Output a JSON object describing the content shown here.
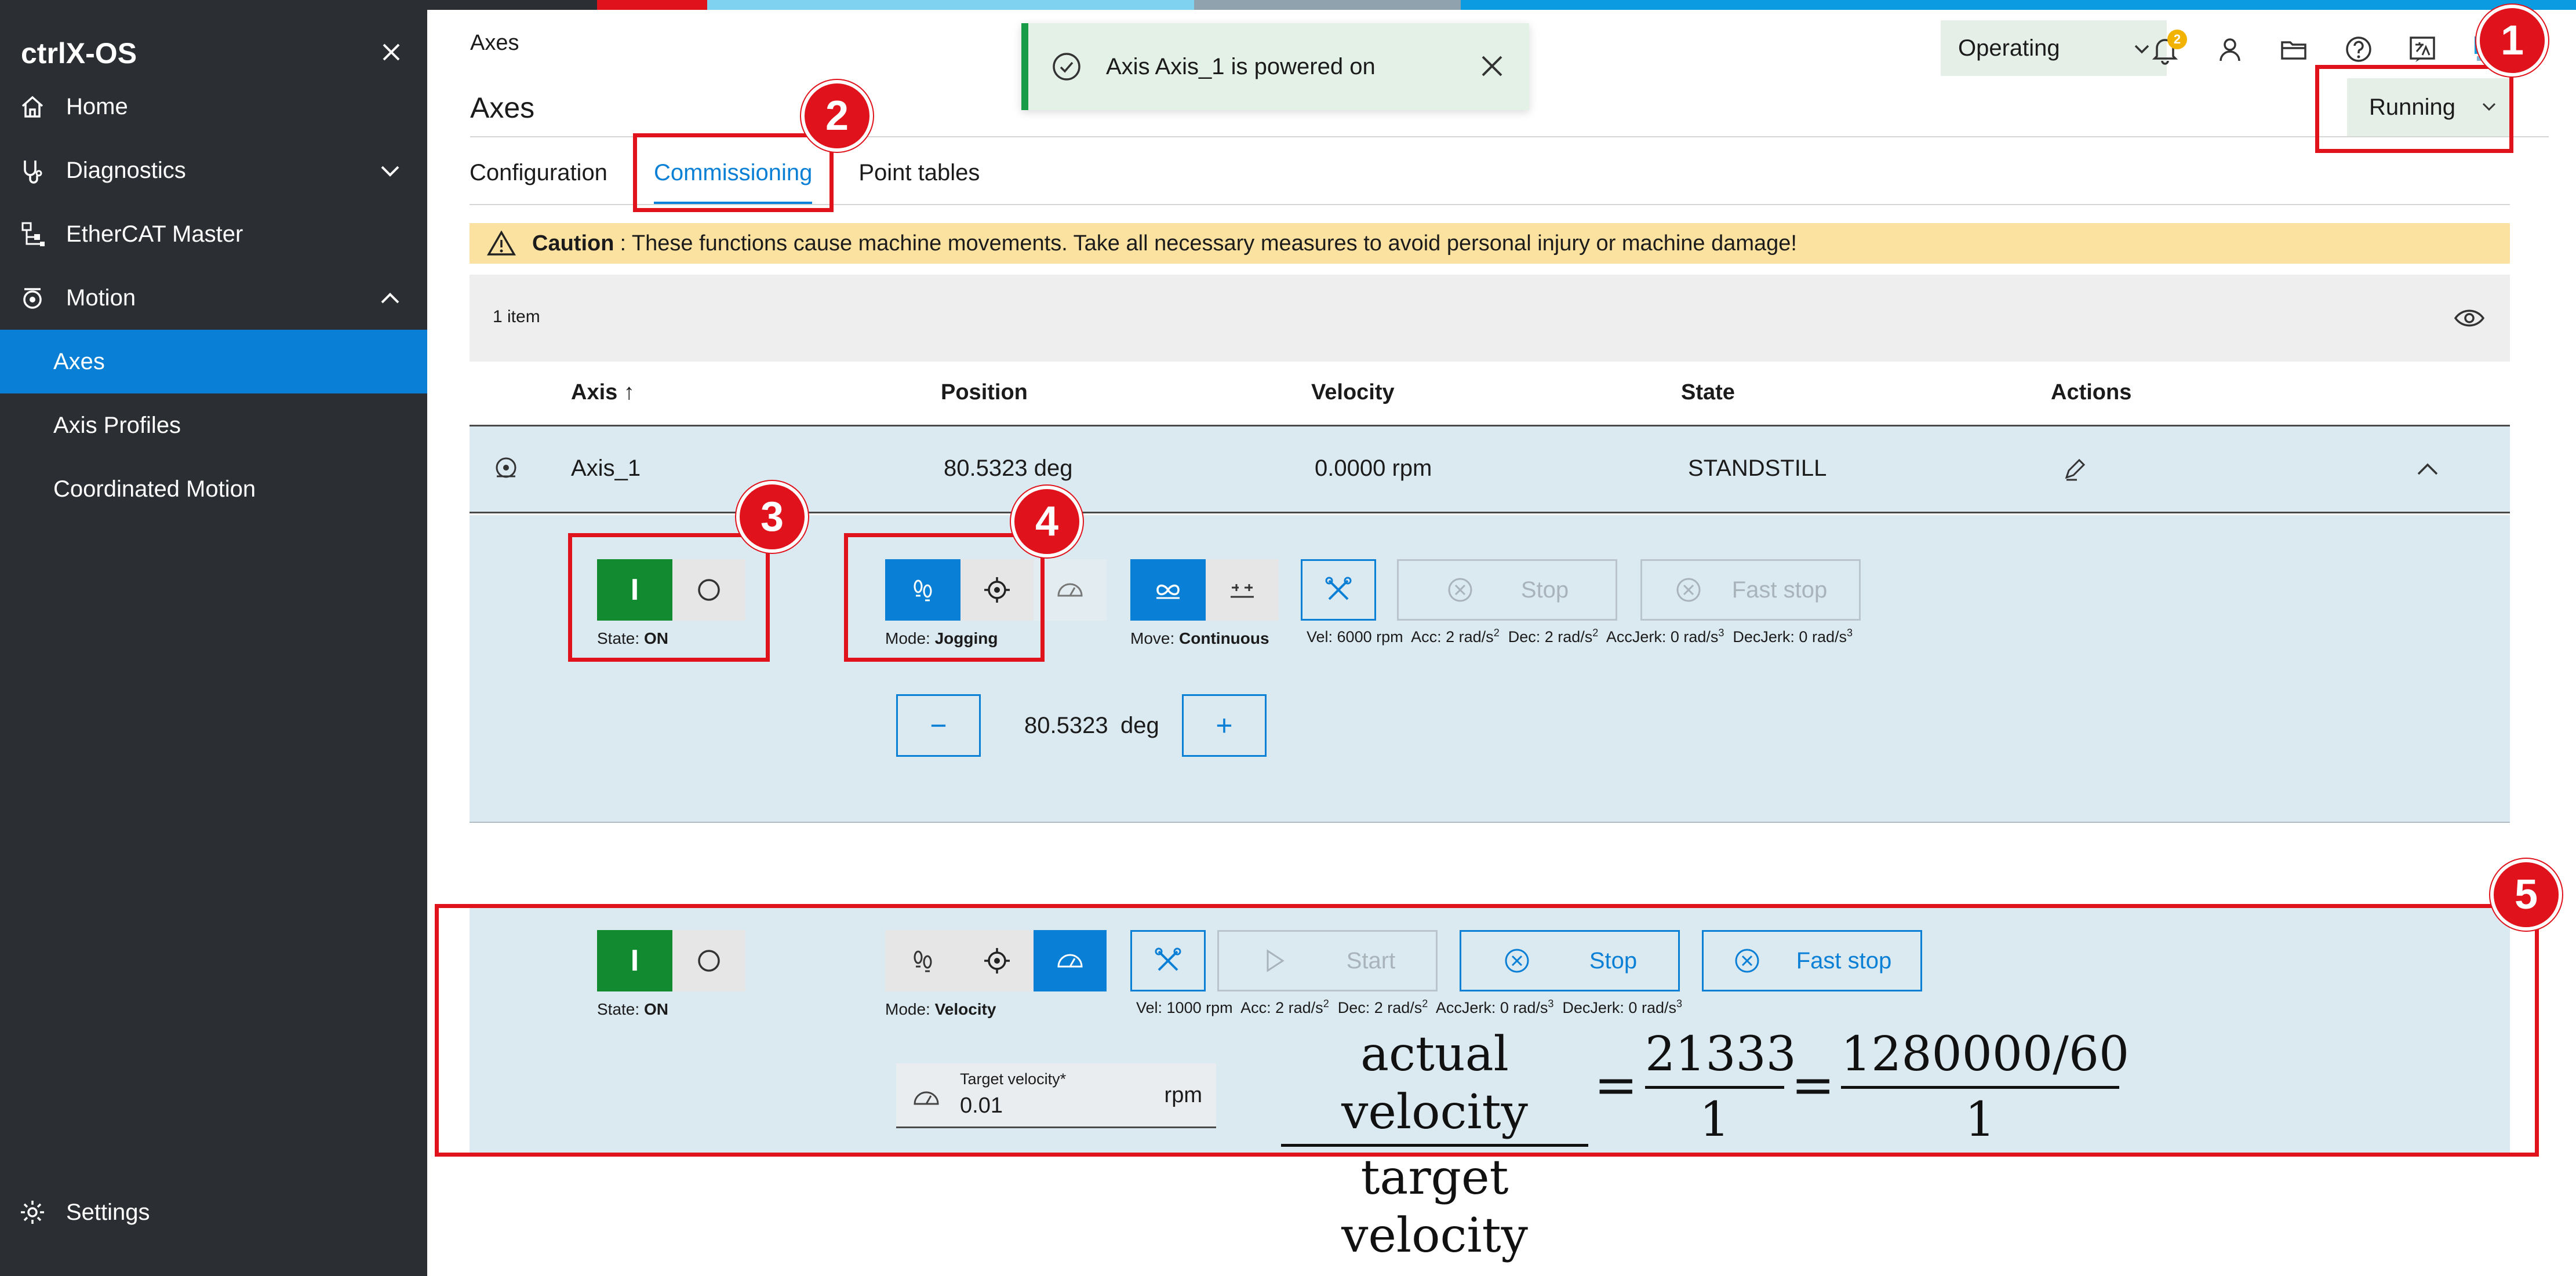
{
  "app": {
    "brand": "ctrlX-OS",
    "topbar_colors": [
      "#2b2e33",
      "#e0121b",
      "#7fd3f0",
      "#8fa2ad",
      "#0a9be0"
    ]
  },
  "sidebar": {
    "items": [
      {
        "label": "Home",
        "icon": "home-icon"
      },
      {
        "label": "Diagnostics",
        "icon": "stethoscope-icon"
      },
      {
        "label": "EtherCAT Master",
        "icon": "network-icon"
      },
      {
        "label": "Motion",
        "icon": "motion-icon"
      },
      {
        "label": "Axes"
      },
      {
        "label": "Axis Profiles"
      },
      {
        "label": "Coordinated Motion"
      }
    ],
    "settings_label": "Settings",
    "active_color": "#0a7fd6"
  },
  "header": {
    "breadcrumb": "Axes",
    "title": "Axes",
    "operating_mode": "Operating",
    "notifications_count": "2",
    "run_state": "Running"
  },
  "toast": {
    "message": "Axis Axis_1 is powered on"
  },
  "tabs": [
    {
      "label": "Configuration",
      "active": false
    },
    {
      "label": "Commissioning",
      "active": true
    },
    {
      "label": "Point tables",
      "active": false
    }
  ],
  "caution": {
    "title": "Caution",
    "text": ": These functions cause machine movements. Take all necessary measures to avoid personal injury or machine damage!"
  },
  "table": {
    "count": "1 item",
    "headers": [
      "Axis ↑",
      "Position",
      "Velocity",
      "State",
      "Actions"
    ],
    "rows": [
      {
        "axis": "Axis_1",
        "position": "80.5323 deg",
        "velocity": "0.0000 rpm",
        "state": "STANDSTILL"
      }
    ]
  },
  "jog_panel": {
    "power_on_label": "I",
    "state_label": "State:",
    "state_value": "ON",
    "mode_label": "Mode:",
    "mode_value": "Jogging",
    "move_label": "Move:",
    "move_value": "Continuous",
    "stop_label": "Stop",
    "fast_stop_label": "Fast stop",
    "params": {
      "vel": "Vel: 6000 rpm",
      "acc": "Acc: 2 rad/s",
      "dec": "Dec: 2 rad/s",
      "accjerk": "AccJerk: 0 rad/s",
      "decjerk": "DecJerk: 0 rad/s",
      "exp2": "2",
      "exp3": "3"
    },
    "position_value": "80.5323",
    "position_unit": "deg",
    "minus": "−",
    "plus": "+"
  },
  "velocity_panel": {
    "power_on_label": "I",
    "state_label": "State:",
    "state_value": "ON",
    "mode_label": "Mode:",
    "mode_value": "Velocity",
    "start_label": "Start",
    "stop_label": "Stop",
    "fast_stop_label": "Fast stop",
    "params": {
      "vel": "Vel: 1000 rpm",
      "acc": "Acc: 2 rad/s",
      "dec": "Dec: 2 rad/s",
      "accjerk": "AccJerk: 0 rad/s",
      "decjerk": "DecJerk: 0 rad/s",
      "exp2": "2",
      "exp3": "3"
    },
    "target_label": "Target velocity*",
    "target_value": "0.01",
    "target_unit": "rpm"
  },
  "formula": {
    "num1": "actual velocity",
    "den1": "target velocity",
    "num2": "21333",
    "den2": "1",
    "num3": "1280000/60",
    "den3": "1",
    "eq": "="
  },
  "callouts": [
    "1",
    "2",
    "3",
    "4",
    "5"
  ],
  "colors": {
    "annotation_red": "#e0121b",
    "primary_blue": "#0a7fd6",
    "on_green": "#128a30",
    "panel_bg": "#dbe9f1",
    "caution_bg": "#fbe2a0"
  }
}
